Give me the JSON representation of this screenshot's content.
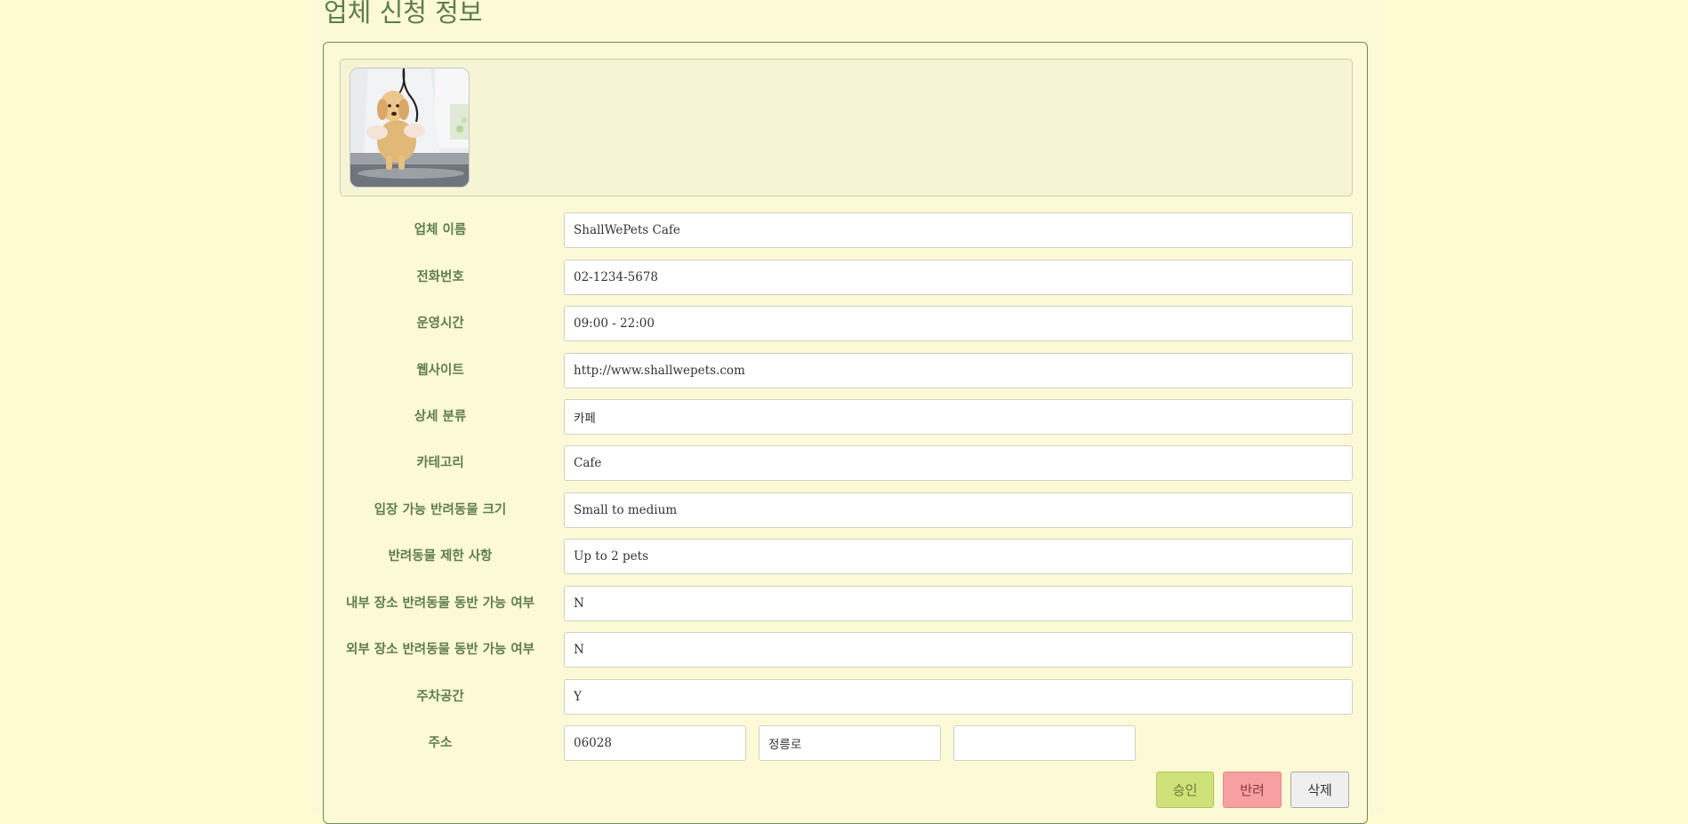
{
  "page": {
    "title": "업체 신청 정보"
  },
  "business_image": {
    "alt": "golden retriever puppy at veterinarian"
  },
  "fields": [
    {
      "label": "업체 이름",
      "value": "ShallWePets Cafe"
    },
    {
      "label": "전화번호",
      "value": "02-1234-5678"
    },
    {
      "label": "운영시간",
      "value": "09:00 - 22:00"
    },
    {
      "label": "웹사이트",
      "value": "http://www.shallwepets.com"
    },
    {
      "label": "상세 분류",
      "value": "카페"
    },
    {
      "label": "카테고리",
      "value": "Cafe"
    },
    {
      "label": "입장 가능 반려동물 크기",
      "value": "Small to medium"
    },
    {
      "label": "반려동물 제한 사항",
      "value": "Up to 2 pets"
    },
    {
      "label": "내부 장소 반려동물 동반 가능 여부",
      "value": "N"
    },
    {
      "label": "외부 장소 반려동물 동반 가능 여부",
      "value": "N"
    },
    {
      "label": "주차공간",
      "value": "Y"
    }
  ],
  "address": {
    "label": "주소",
    "postcode": "06028",
    "road": "정릉로",
    "detail": ""
  },
  "actions": {
    "approve": "승인",
    "reject": "반려",
    "delete": "삭제"
  },
  "colors": {
    "background": "#fefcd0",
    "accent_text": "#5f7d4f",
    "approve": "#cfe27a",
    "reject": "#f7a0a2",
    "delete": "#efefef"
  }
}
